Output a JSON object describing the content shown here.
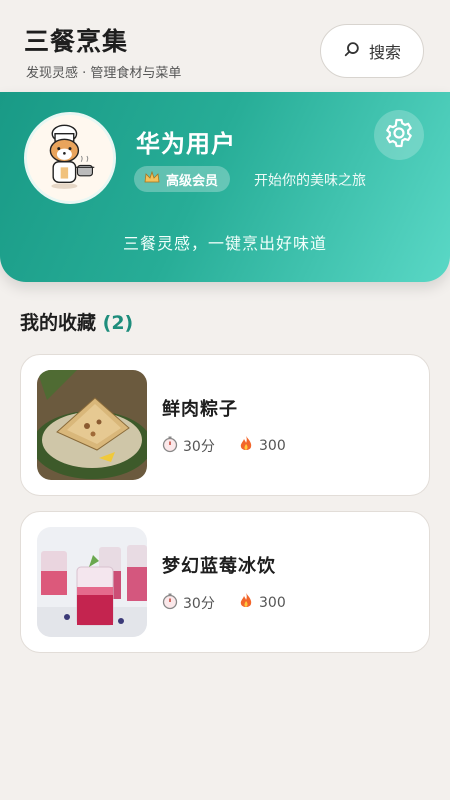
{
  "header": {
    "title": "三餐烹集",
    "subtitle": "发现灵感 · 管理食材与菜单",
    "search_label": "搜索"
  },
  "profile": {
    "username": "华为用户",
    "badge": "高级会员",
    "tagline": "开始你的美味之旅",
    "slogan": "三餐灵感，一键烹出好味道",
    "accent_color": "#1f9f8a"
  },
  "favorites": {
    "title": "我的收藏",
    "count": "(2)",
    "items": [
      {
        "name": "鲜肉粽子",
        "time": "30分",
        "calories": "300",
        "image": "zongzi-photo"
      },
      {
        "name": "梦幻蓝莓冰饮",
        "time": "30分",
        "calories": "300",
        "image": "berry-drink-photo"
      }
    ]
  },
  "icons": {
    "search": "search-icon",
    "settings": "gear-icon",
    "timer": "timer-icon",
    "calories": "flame-icon",
    "badge": "crown-icon"
  }
}
